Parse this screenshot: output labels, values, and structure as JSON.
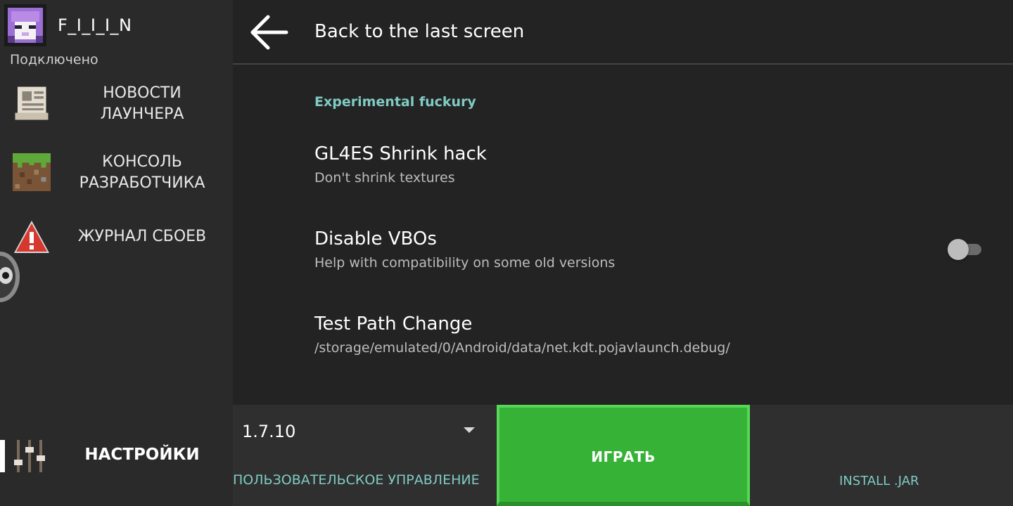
{
  "sidebar": {
    "username": "F_I_I_I_N",
    "status": "Подключено",
    "items": [
      {
        "label_line1": "НОВОСТИ",
        "label_line2": "ЛАУНЧЕРА",
        "icon": "news-icon"
      },
      {
        "label_line1": "КОНСОЛЬ",
        "label_line2": "РАЗРАБОТЧИКА",
        "icon": "grass-block-icon"
      },
      {
        "label_line1": "ЖУРНАЛ СБОЕВ",
        "label_line2": "",
        "icon": "warning-icon"
      }
    ],
    "settings": {
      "label": "НАСТРОЙКИ",
      "icon": "sliders-icon"
    }
  },
  "header": {
    "back_title": "Back to the last screen"
  },
  "settings": {
    "category": "Experimental fuckury",
    "prefs": [
      {
        "title": "GL4ES Shrink hack",
        "summary": "Don't shrink textures"
      },
      {
        "title": "Disable VBOs",
        "summary": "Help with compatibility on some old versions",
        "toggle": false
      },
      {
        "title": "Test Path Change",
        "summary": "/storage/emulated/0/Android/data/net.kdt.pojavlaunch.debug/"
      }
    ]
  },
  "bottom": {
    "version": "1.7.10",
    "custom_controls": "ПОЛЬЗОВАТЕЛЬСКОЕ УПРАВЛЕНИЕ",
    "play": "ИГРАТЬ",
    "install_jar": "INSTALL .JAR"
  },
  "colors": {
    "accent": "#80cbc4",
    "play_green": "#36b236",
    "background": "#232323",
    "sidebar": "#2a2a2a"
  }
}
